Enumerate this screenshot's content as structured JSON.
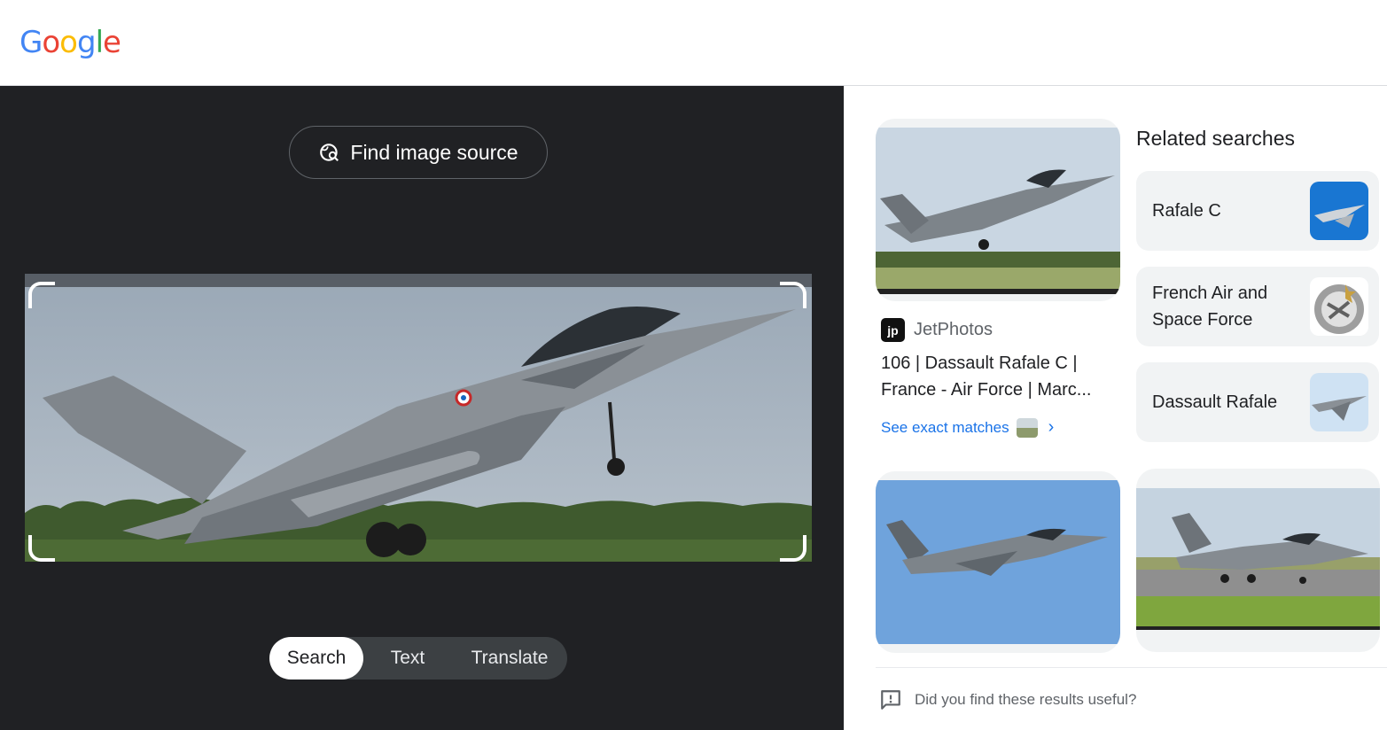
{
  "header": {
    "logo_letters": [
      {
        "ch": "G",
        "color": "#4285F4"
      },
      {
        "ch": "o",
        "color": "#EA4335"
      },
      {
        "ch": "o",
        "color": "#FBBC05"
      },
      {
        "ch": "g",
        "color": "#4285F4"
      },
      {
        "ch": "l",
        "color": "#34A853"
      },
      {
        "ch": "e",
        "color": "#EA4335"
      }
    ]
  },
  "lens": {
    "find_source_label": "Find image source",
    "modes": [
      "Search",
      "Text",
      "Translate"
    ],
    "active_mode": "Search"
  },
  "results": {
    "top_result": {
      "source_logo_text": "jp",
      "source_name": "JetPhotos",
      "title_line1": "106 | Dassault Rafale C |",
      "title_line2": "France - Air Force | Marc...",
      "exact_matches_label": "See exact matches"
    },
    "related_heading": "Related searches",
    "related": [
      {
        "label": "Rafale C"
      },
      {
        "label": "French Air and Space Force"
      },
      {
        "label": "Dassault Rafale"
      }
    ],
    "feedback_text": "Did you find these results useful?"
  },
  "colors": {
    "dark_pane": "#202124",
    "link_blue": "#1a73e8"
  }
}
